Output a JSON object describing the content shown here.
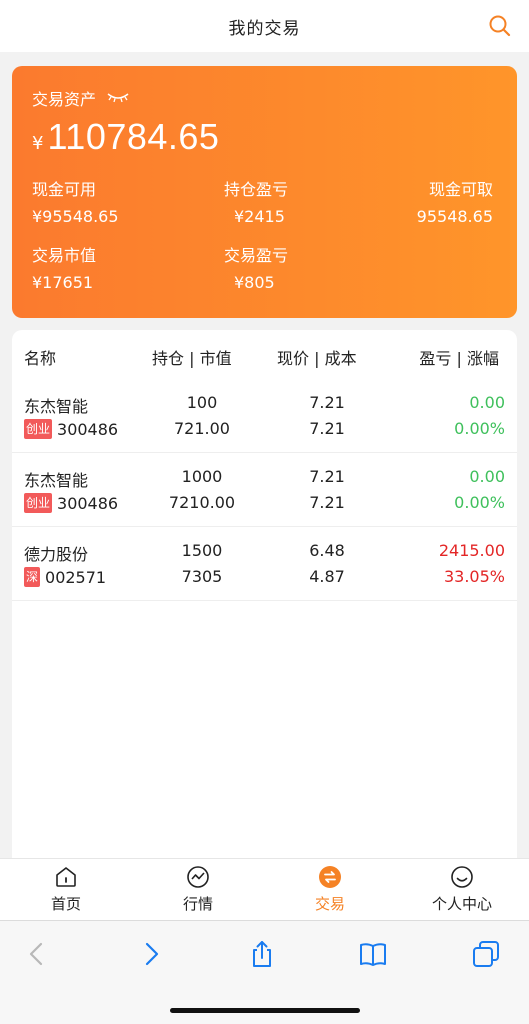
{
  "header": {
    "title": "我的交易",
    "search_icon": "search-icon"
  },
  "assets": {
    "label": "交易资产",
    "currency": "¥",
    "total": "110784.65",
    "cash_available_label": "现金可用",
    "cash_available_value": "¥95548.65",
    "position_pl_label": "持仓盈亏",
    "position_pl_value": "¥2415",
    "cash_withdrawable_label": "现金可取",
    "cash_withdrawable_value": "95548.65",
    "market_value_label": "交易市值",
    "market_value_value": "¥17651",
    "trade_pl_label": "交易盈亏",
    "trade_pl_value": "¥805"
  },
  "table": {
    "headers": [
      "名称",
      "持仓 | 市值",
      "现价 | 成本",
      "盈亏 | 涨幅"
    ],
    "rows": [
      {
        "name": "东杰智能",
        "tag": "创业",
        "code": "300486",
        "hold": "100",
        "value": "721.00",
        "price": "7.21",
        "cost": "7.21",
        "pl": "0.00",
        "pct": "0.00%",
        "pl_color": "green"
      },
      {
        "name": "东杰智能",
        "tag": "创业",
        "code": "300486",
        "hold": "1000",
        "value": "7210.00",
        "price": "7.21",
        "cost": "7.21",
        "pl": "0.00",
        "pct": "0.00%",
        "pl_color": "green"
      },
      {
        "name": "德力股份",
        "tag": "深",
        "code": "002571",
        "hold": "1500",
        "value": "7305",
        "price": "6.48",
        "cost": "4.87",
        "pl": "2415.00",
        "pct": "33.05%",
        "pl_color": "red"
      }
    ]
  },
  "tabbar": {
    "items": [
      {
        "label": "首页",
        "icon": "home-icon"
      },
      {
        "label": "行情",
        "icon": "trend-icon"
      },
      {
        "label": "交易",
        "icon": "exchange-icon",
        "active": true
      },
      {
        "label": "个人中心",
        "icon": "smile-icon"
      }
    ]
  },
  "colors": {
    "accent": "#f58225",
    "up": "#e32626",
    "down": "#3fc05c",
    "ios_blue": "#1a7cf0"
  }
}
